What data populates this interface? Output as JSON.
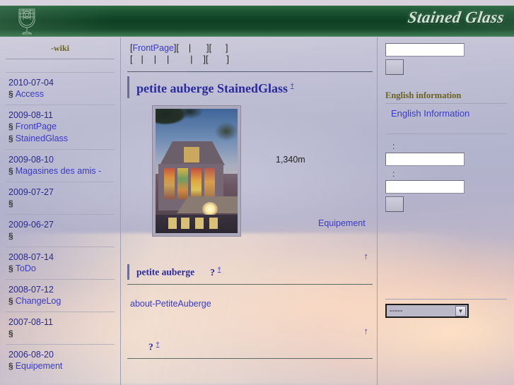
{
  "header": {
    "brand": "Stained Glass",
    "logo_icon": "stained-glass-goblet-icon"
  },
  "left_sidebar": {
    "title": "-wiki",
    "recent_changes": [
      {
        "date": "2010-07-04",
        "items": [
          {
            "marker": "§",
            "label": "Access"
          }
        ]
      },
      {
        "date": "2009-08-11",
        "items": [
          {
            "marker": "§",
            "label": "FrontPage"
          },
          {
            "marker": "§",
            "label": "StainedGlass"
          }
        ]
      },
      {
        "date": "2009-08-10",
        "items": [
          {
            "marker": "§",
            "label": "Magasines des amis -"
          }
        ]
      },
      {
        "date": "2009-07-27",
        "items": [
          {
            "marker": "§",
            "label": ""
          }
        ]
      },
      {
        "date": "2009-06-27",
        "items": [
          {
            "marker": "§",
            "label": ""
          }
        ]
      },
      {
        "date": "2008-07-14",
        "items": [
          {
            "marker": "§",
            "label": "ToDo"
          }
        ]
      },
      {
        "date": "2008-07-12",
        "items": [
          {
            "marker": "§",
            "label": "ChangeLog"
          }
        ]
      },
      {
        "date": "2007-08-11",
        "items": [
          {
            "marker": "§",
            "label": ""
          }
        ]
      },
      {
        "date": "2006-08-20",
        "items": [
          {
            "marker": "§",
            "label": "Equipement"
          }
        ]
      }
    ]
  },
  "center": {
    "nav_row1": {
      "open1": "[",
      "link": "FrontPage",
      "close1": "]",
      "open2": "[",
      "pipe2": "|",
      "close2": "]",
      "open3": "[",
      "close3": "]"
    },
    "nav_row2": {
      "open1": "[",
      "pipe_a": "|",
      "pipe_b": "|",
      "pipe_c": "|",
      "pipe_d": "|",
      "close1": "]",
      "open2": "[",
      "close2": "]"
    },
    "page_title": "petite auberge StainedGlass",
    "page_title_anchor": "†",
    "photo": {
      "alt": "petite-auberge-building-photo"
    },
    "altitude_note": "1,340m",
    "equipement_link": "Equipement",
    "up_arrow_1": "↑",
    "section2_title": "petite auberge",
    "section2_missing": "?",
    "section2_anchor": "†",
    "about_link": "about-PetiteAuberge",
    "up_arrow_2": "↑",
    "section3_missing": "?",
    "section3_anchor": "†"
  },
  "right_sidebar": {
    "search_value": "",
    "search_placeholder": "",
    "search_button_label": "",
    "english_heading": "English information",
    "english_link": "English Information",
    "form_label_1": ":",
    "form_value_1": "",
    "form_label_2": ":",
    "form_value_2": "",
    "form_button_label": "",
    "select_value": "-----",
    "select_arrow_icon": "chevron-down-icon"
  },
  "colors": {
    "header_green": "#0e3f22",
    "link_blue": "#3a3ac8",
    "title_blue": "#2a2a9e",
    "heading_olive": "#6b6320",
    "brand_light": "#cfe3d4"
  }
}
